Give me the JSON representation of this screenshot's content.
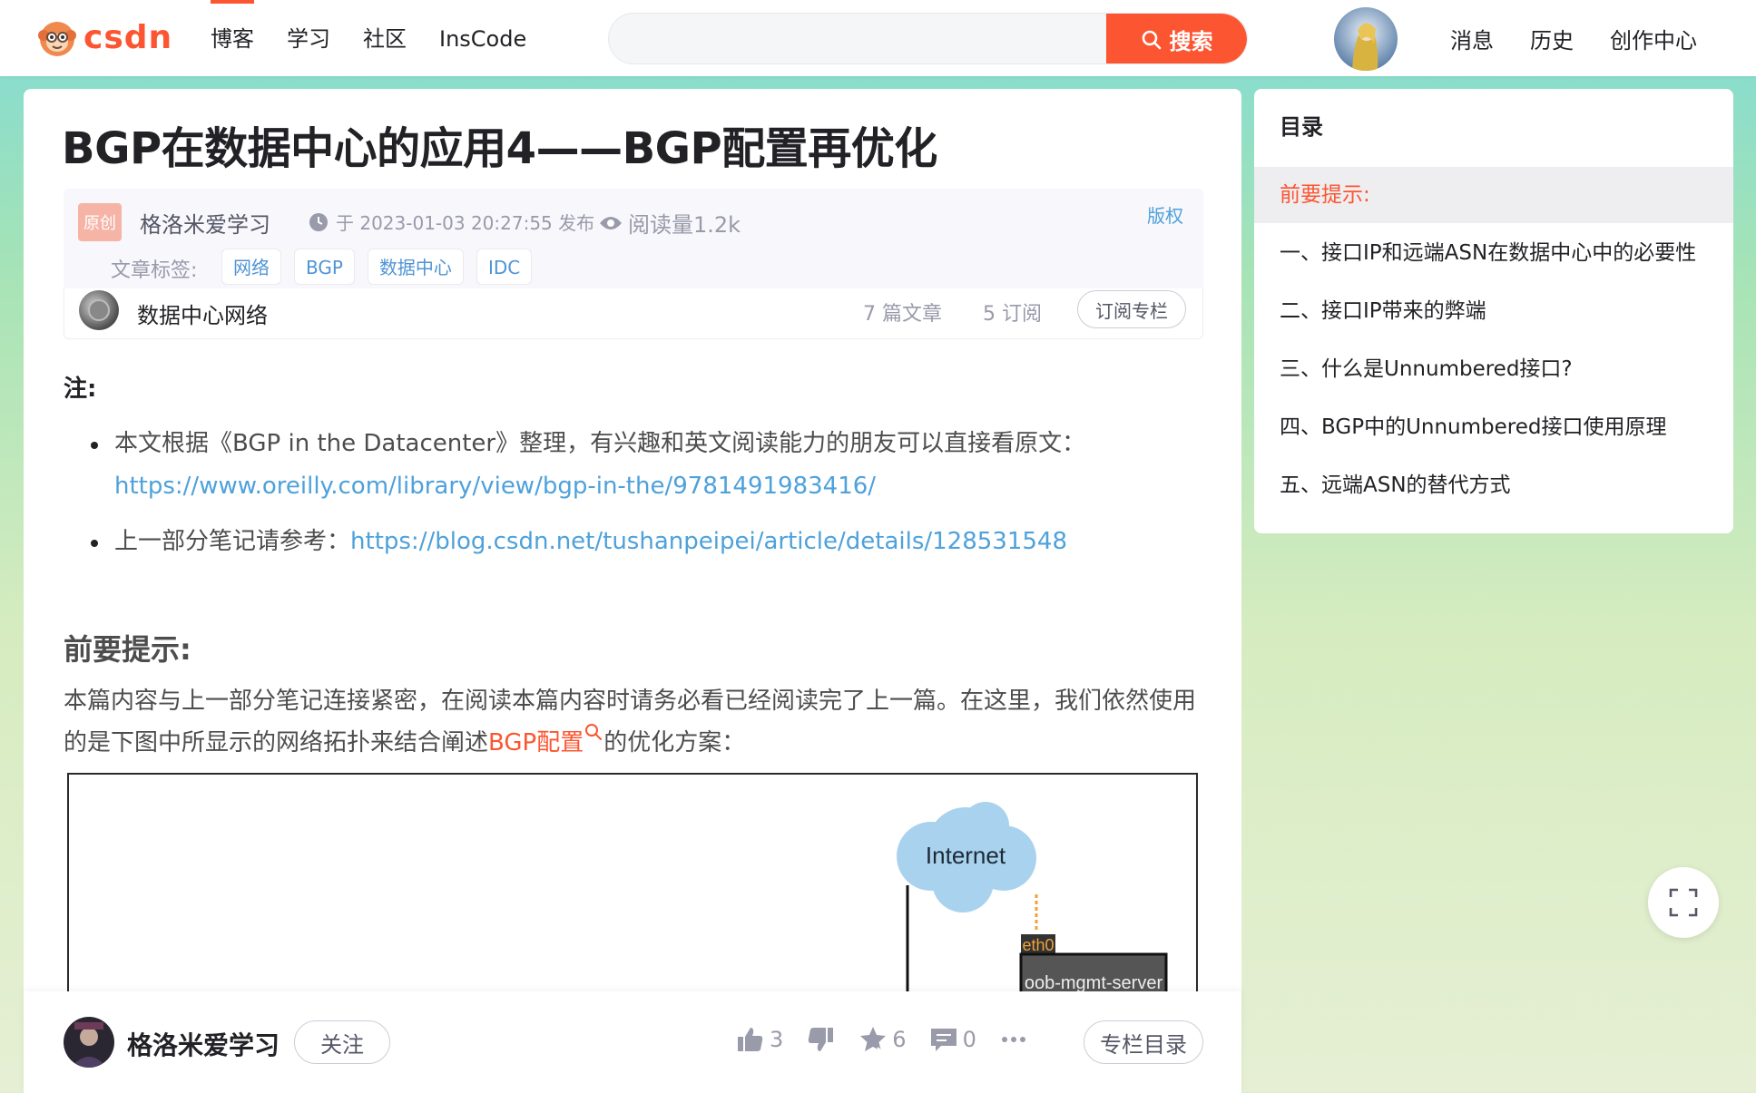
{
  "brand": {
    "name": "csdn",
    "accent": "#fc5531"
  },
  "nav": {
    "items": [
      {
        "label": "博客"
      },
      {
        "label": "学习"
      },
      {
        "label": "社区"
      },
      {
        "label": "InsCode"
      }
    ],
    "right_links": [
      {
        "label": "消息"
      },
      {
        "label": "历史"
      },
      {
        "label": "创作中心"
      }
    ]
  },
  "search": {
    "placeholder": "",
    "button_label": "搜索"
  },
  "article": {
    "title": "BGP在数据中心的应用4——BGP配置再优化",
    "original_badge": "原创",
    "author": "格洛米爱学习",
    "date": "于 2023-01-03 20:27:55 发布",
    "views": "阅读量1.2k",
    "copyright": "版权",
    "tags_label": "文章标签:",
    "tags": [
      "网络",
      "BGP",
      "数据中心",
      "IDC"
    ],
    "column": {
      "name": "数据中心网络",
      "articles": "7 篇文章",
      "subscriptions": "5 订阅",
      "subscribe_label": "订阅专栏"
    },
    "note_heading": "注:",
    "bullets": [
      {
        "text": "本文根据《BGP in the Datacenter》整理，有兴趣和英文阅读能力的朋友可以直接看原文：",
        "link": "https://www.oreilly.com/library/view/bgp-in-the/9781491983416/"
      },
      {
        "text": "上一部分笔记请参考：",
        "link": "https://blog.csdn.net/tushanpeipei/article/details/128531548"
      }
    ],
    "section_heading": "前要提示:",
    "paragraph_before": "本篇内容与上一部分笔记连接紧密，在阅读本篇内容时请务必看已经阅读完了上一篇。在这里，我们依然使用的是下图中所显示的网络拓扑来结合阐述",
    "paragraph_keyword": "BGP配置",
    "paragraph_after": "的优化方案：",
    "diagram": {
      "cloud_label": "Internet",
      "port_label": "eth0",
      "server_label": "oob-mgmt-server"
    }
  },
  "toolbar": {
    "author": "格洛米爱学习",
    "follow_label": "关注",
    "likes": "3",
    "favorites": "6",
    "comments": "0",
    "column_dir_label": "专栏目录"
  },
  "toc": {
    "title": "目录",
    "items": [
      {
        "label": "前要提示:",
        "active": true
      },
      {
        "label": "一、接口IP和远端ASN在数据中心中的必要性"
      },
      {
        "label": "二、接口IP带来的弊端"
      },
      {
        "label": "三、什么是Unnumbered接口?"
      },
      {
        "label": "四、BGP中的Unnumbered接口使用原理"
      },
      {
        "label": "五、远端ASN的替代方式"
      }
    ]
  }
}
